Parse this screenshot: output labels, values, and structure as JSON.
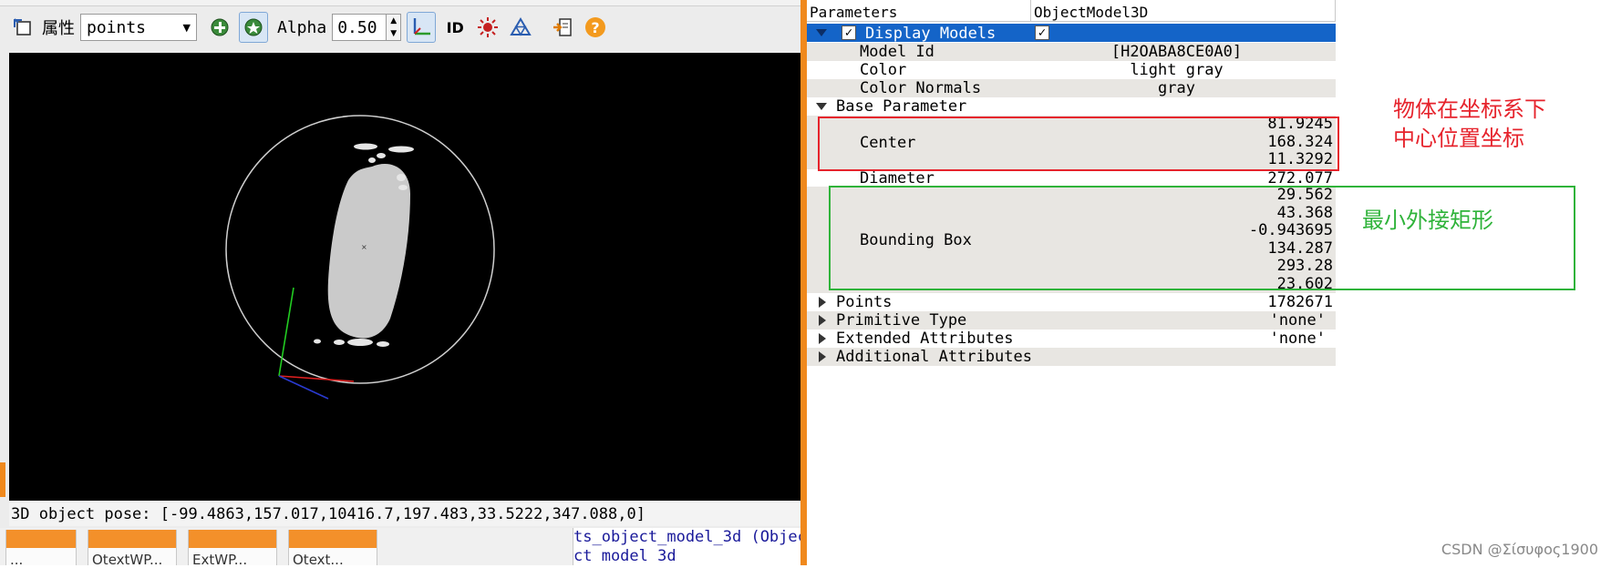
{
  "toolbar": {
    "properties_label": "属性",
    "mode_select": "points",
    "alpha_label": "Alpha",
    "alpha_value": "0.50",
    "id_button": "ID"
  },
  "viewer": {
    "status_text": "3D object pose: [-99.4863,157.017,10416.7,197.483,33.5222,347.088,0]"
  },
  "bottom": {
    "tabs": [
      "...",
      "OtextWP...",
      "ExtWP...",
      "Otext..."
    ],
    "code_lines": [
      "ts_object_model_3d (Objec",
      "ct model 3d"
    ]
  },
  "tree": {
    "col_parameters": "Parameters",
    "col_value": "ObjectModel3D",
    "display_models": "Display Models",
    "model_id_label": "Model Id",
    "model_id_value": "[H2OABA8CE0A0]",
    "color_label": "Color",
    "color_value": "light gray",
    "color_normals_label": "Color Normals",
    "color_normals_value": "gray",
    "base_parameter": "Base Parameter",
    "center_label": "Center",
    "center_values": [
      "81.9245",
      "168.324",
      "11.3292"
    ],
    "diameter_label": "Diameter",
    "diameter_value": "272.077",
    "bbox_label": "Bounding Box",
    "bbox_values": [
      "29.562",
      "43.368",
      "-0.943695",
      "134.287",
      "293.28",
      "23.602"
    ],
    "points_label": "Points",
    "points_value": "1782671",
    "primitive_label": "Primitive Type",
    "primitive_value": "'none'",
    "extended_label": "Extended Attributes",
    "extended_value": "'none'",
    "additional_label": "Additional Attributes"
  },
  "annotations": {
    "center_note_1": "物体在坐标系下",
    "center_note_2": "中心位置坐标",
    "bbox_note": "最小外接矩形",
    "watermark": "CSDN @Σίσυφος1900"
  },
  "colors": {
    "accent_orange": "#f0891d",
    "selection_blue": "#1464c8",
    "annotation_red": "#e6232c",
    "annotation_green": "#2fb33a"
  }
}
